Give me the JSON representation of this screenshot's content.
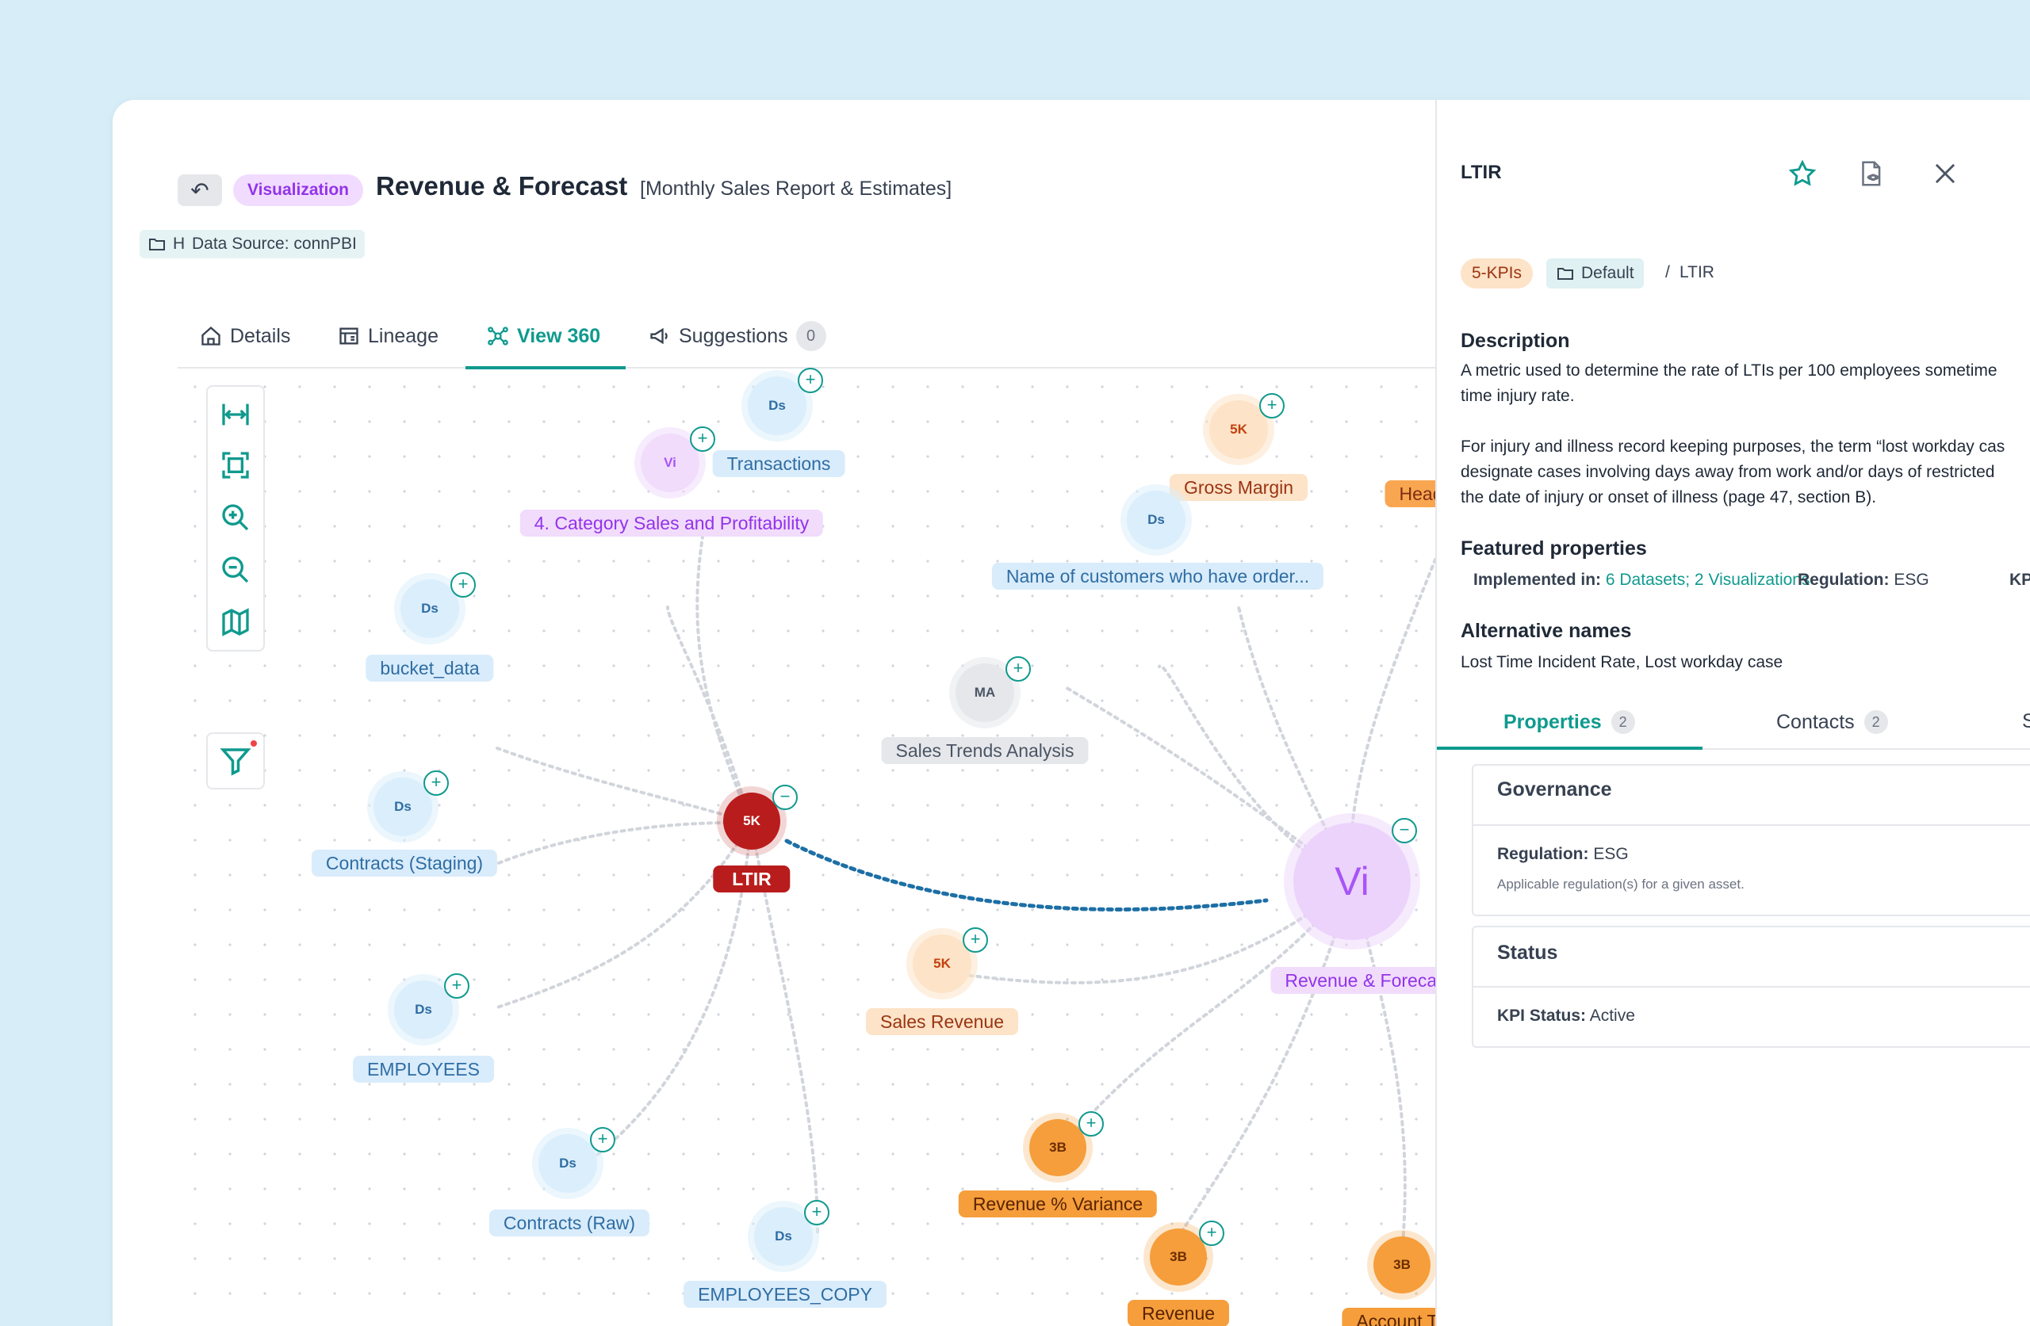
{
  "header": {
    "back_icon": "back-arrow-icon",
    "type_pill": "Visualization",
    "title": "Revenue & Forecast",
    "subtitle": "[Monthly Sales Report & Estimates]",
    "tags": [
      {
        "label": "HR",
        "icon": "folder-icon"
      },
      {
        "label": "Data Source: connPBI"
      }
    ]
  },
  "tabs": [
    {
      "label": "Details",
      "icon": "home-icon"
    },
    {
      "label": "Lineage",
      "icon": "lineage-icon"
    },
    {
      "label": "View 360",
      "icon": "graph-icon",
      "active": true
    },
    {
      "label": "Suggestions",
      "icon": "megaphone-icon",
      "count": "0"
    }
  ],
  "toolbar": [
    "fit-width-icon",
    "fit-screen-icon",
    "zoom-in-icon",
    "zoom-out-icon",
    "map-icon"
  ],
  "graph": {
    "center": {
      "badge": "5K",
      "label": "LTIR"
    },
    "target": {
      "badge": "Vi",
      "label": "Revenue & Forecas"
    },
    "nodes": [
      {
        "badge": "Ds",
        "label": "Transactions"
      },
      {
        "badge": "Vi",
        "label": "4. Category Sales and Profitability"
      },
      {
        "badge": "Ds",
        "label": "bucket_data"
      },
      {
        "badge": "Ds",
        "label": "Contracts (Staging)"
      },
      {
        "badge": "Ds",
        "label": "EMPLOYEES"
      },
      {
        "badge": "Ds",
        "label": "Contracts (Raw)"
      },
      {
        "badge": "Ds",
        "label": "EMPLOYEES_COPY"
      },
      {
        "badge": "MA",
        "label": "Sales Trends Analysis"
      },
      {
        "badge": "5K",
        "label": "Gross Margin"
      },
      {
        "badge": "Ds",
        "label": "Name of customers who have order..."
      },
      {
        "badge": "5K",
        "label": "Sales Revenue"
      },
      {
        "badge": "3B",
        "label": "Revenue % Variance"
      },
      {
        "badge": "3B",
        "label": "Revenue"
      },
      {
        "badge": "3B",
        "label": "Account T"
      },
      {
        "badge": "",
        "label": "Head"
      }
    ]
  },
  "panel": {
    "title": "LTIR",
    "icons": [
      "star-icon",
      "document-view-icon",
      "close-icon"
    ],
    "kpi_chip": "5-KPIs",
    "folder": "Default",
    "crumb_sep": "/",
    "crumb_last": "LTIR",
    "description_heading": "Description",
    "description_lines": [
      "A metric used to determine the rate of LTIs per 100 employees sometime",
      "time injury rate.",
      "For injury and illness record keeping purposes, the term “lost workday cas",
      "designate cases involving days away from work and/or days of restricted",
      "the date of injury or onset of illness (page 47, section B)."
    ],
    "featured_heading": "Featured properties",
    "implemented_key": "Implemented in:",
    "implemented_value": "6 Datasets; 2 Visualizations",
    "regulation_key": "Regulation:",
    "regulation_value": "ESG",
    "kpi_cut": "KPI",
    "alt_heading": "Alternative names",
    "alt_names": "Lost Time Incident Rate,  Lost workday case",
    "tabs": [
      {
        "label": "Properties",
        "count": "2",
        "active": true
      },
      {
        "label": "Contacts",
        "count": "2"
      },
      {
        "label": "S"
      }
    ],
    "governance": {
      "heading": "Governance",
      "key": "Regulation:",
      "value": "ESG",
      "help": "Applicable regulation(s) for a given asset."
    },
    "status": {
      "heading": "Status",
      "key": "KPI Status:",
      "value": "Active"
    },
    "colors": {
      "accent": "#0f9a8e",
      "ltir": "#b91c1c",
      "viz": "#a855f7"
    }
  }
}
